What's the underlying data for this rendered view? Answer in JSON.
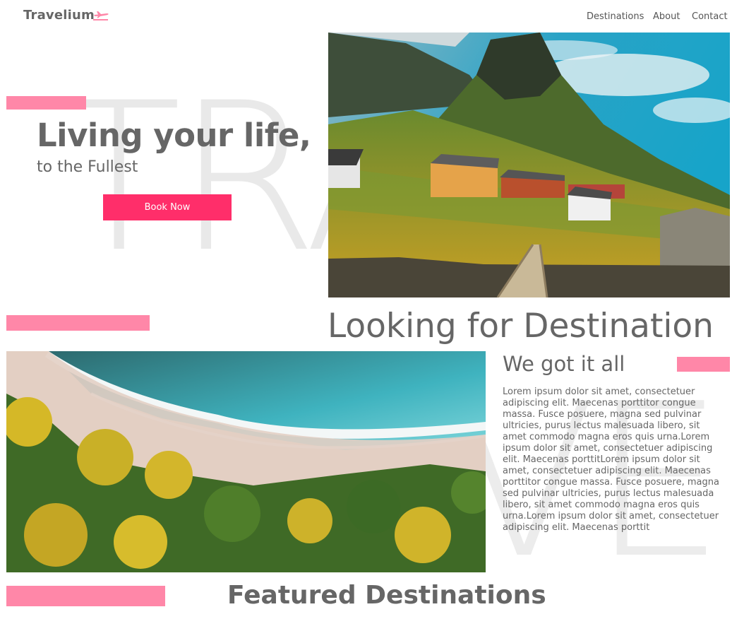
{
  "header": {
    "logo_text": "Travelium",
    "logo_icon": "plane-takeoff-icon",
    "nav": [
      "Destinations",
      "About",
      "Contact"
    ]
  },
  "hero": {
    "watermark": "TRA",
    "title": "Living your life,",
    "subtitle": "to the Fullest",
    "cta_label": "Book Now"
  },
  "destination": {
    "heading": "Looking for Destination",
    "subheading": "We got it all",
    "watermark": "VE",
    "paragraph": "Lorem ipsum dolor sit amet, consectetuer adipiscing elit. Maecenas porttitor congue massa. Fusce posuere, magna sed pulvinar ultricies, purus lectus malesuada libero, sit amet commodo magna eros quis urna.Lorem ipsum dolor sit amet, consectetuer adipiscing elit. Maecenas porttitLorem ipsum dolor sit amet, consectetuer adipiscing elit. Maecenas porttitor congue massa. Fusce posuere, magna sed pulvinar ultricies, purus lectus malesuada libero, sit amet commodo magna eros quis urna.Lorem ipsum dolor sit amet, consectetuer adipiscing elit. Maecenas porttit"
  },
  "featured": {
    "heading": "Featured Destinations"
  },
  "colors": {
    "accent": "#ff2e6a",
    "accent_light": "#ff87a8",
    "text": "#666666",
    "watermark": "#e9e9e9"
  }
}
